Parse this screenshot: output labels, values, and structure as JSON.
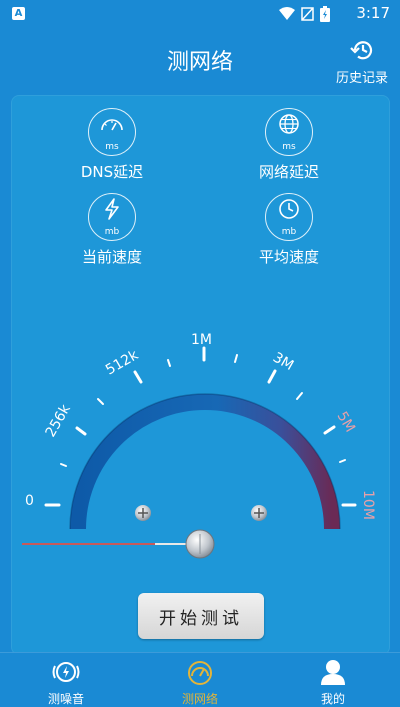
{
  "status_bar": {
    "app_badge": "A",
    "time": "3:17"
  },
  "header": {
    "title": "测网络",
    "history_label": "历史记录"
  },
  "metrics": [
    {
      "label": "DNS延迟",
      "unit": "ms",
      "icon": "speedometer-icon"
    },
    {
      "label": "网络延迟",
      "unit": "ms",
      "icon": "globe-icon"
    },
    {
      "label": "当前速度",
      "unit": "mb",
      "icon": "lightning-icon"
    },
    {
      "label": "平均速度",
      "unit": "mb",
      "icon": "clock-icon"
    }
  ],
  "gauge": {
    "scale_labels": [
      "0",
      "256k",
      "512k",
      "1M",
      "3M",
      "5M",
      "10M"
    ],
    "needle_value": "0"
  },
  "start_button": {
    "label": "开始测试"
  },
  "bottom_nav": {
    "items": [
      {
        "label": "测噪音",
        "icon": "noise-icon",
        "active": false
      },
      {
        "label": "测网络",
        "icon": "network-gauge-icon",
        "active": true
      },
      {
        "label": "我的",
        "icon": "user-icon",
        "active": false
      }
    ]
  },
  "colors": {
    "background": "#1a8ad4",
    "panel": "#1e97d8",
    "active_nav": "#e2b43a"
  }
}
